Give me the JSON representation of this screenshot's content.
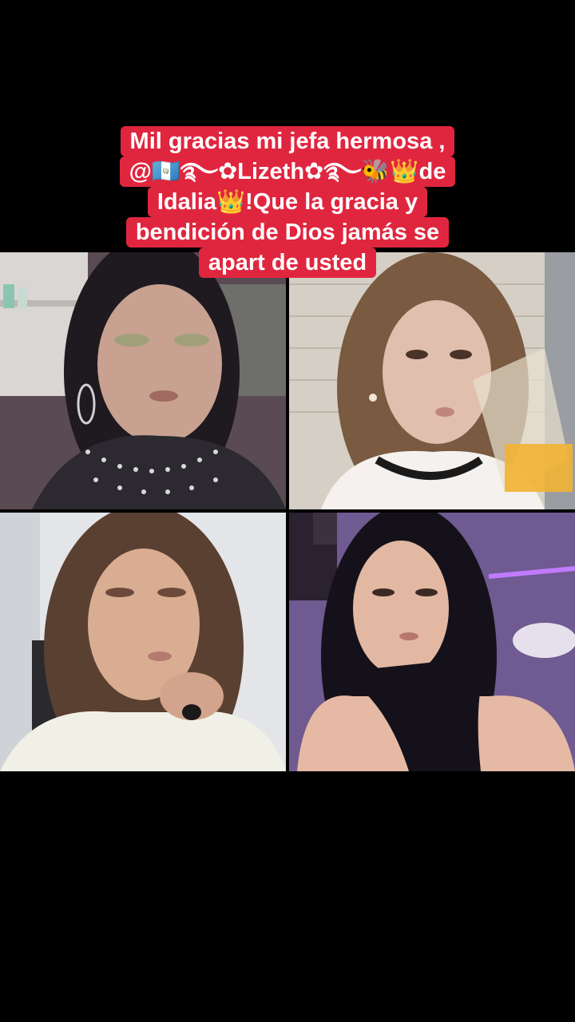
{
  "caption": {
    "lines": [
      "Mil gracias mi jefa hermosa ,",
      "@🇬🇹࿐✿Lizeth✿࿐🐝👑de",
      "Idalia👑!Que la gracia y",
      "bendición de Dios jamás se",
      "apart de usted"
    ]
  },
  "colors": {
    "background": "#000000",
    "caption_bg": "#e0263f",
    "caption_text": "#ffffff"
  },
  "participants": [
    {
      "icon": "video-feed-participant-1"
    },
    {
      "icon": "video-feed-participant-2"
    },
    {
      "icon": "video-feed-participant-3"
    },
    {
      "icon": "video-feed-participant-4"
    }
  ]
}
